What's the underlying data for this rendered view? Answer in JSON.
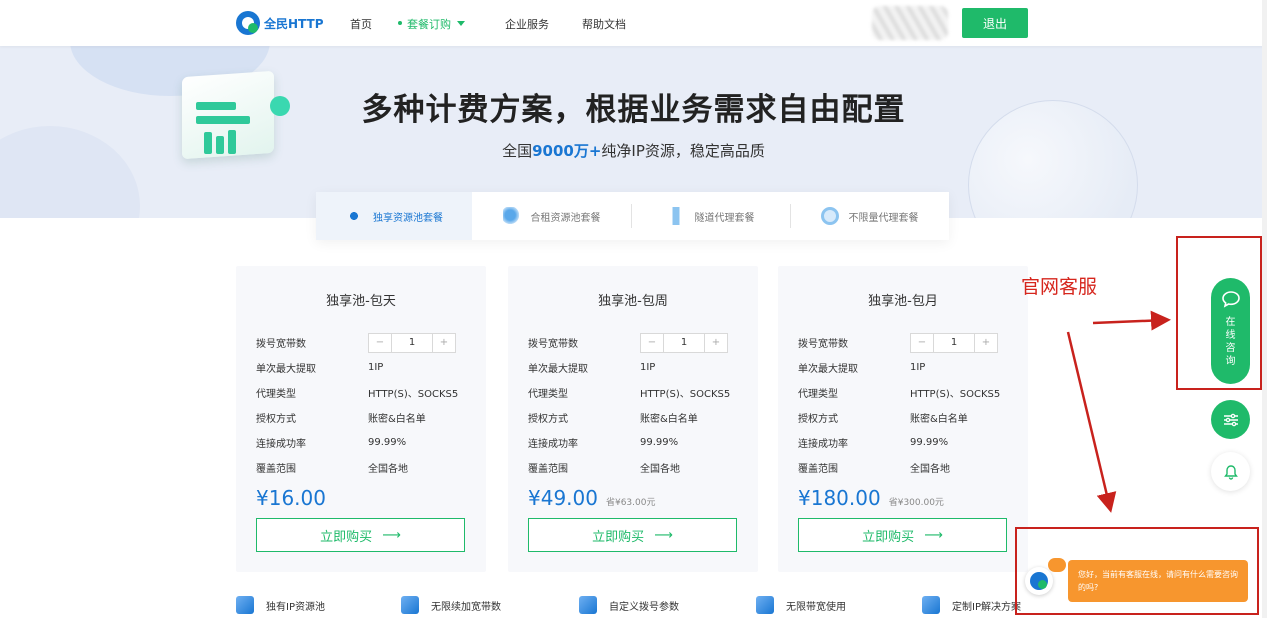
{
  "header": {
    "logo_text": "全民HTTP",
    "nav": [
      "首页",
      "套餐订购",
      "企业服务",
      "帮助文档"
    ],
    "active_nav": "套餐订购",
    "logout_label": "退出"
  },
  "hero": {
    "headline": "多种计费方案，根据业务需求自由配置",
    "sub_prefix": "全国",
    "sub_highlight": "9000万+",
    "sub_suffix": "纯净IP资源，稳定高品质"
  },
  "tabs": [
    {
      "label": "独享资源池套餐",
      "active": true
    },
    {
      "label": "合租资源池套餐",
      "active": false
    },
    {
      "label": "隧道代理套餐",
      "active": false
    },
    {
      "label": "不限量代理套餐",
      "active": false
    }
  ],
  "spec_labels": [
    "拨号宽带数",
    "单次最大提取",
    "代理类型",
    "授权方式",
    "连接成功率",
    "覆盖范围"
  ],
  "cards": [
    {
      "title": "独享池-包天",
      "qty": "1",
      "max_extract": "1IP",
      "proxy_type": "HTTP(S)、SOCKS5",
      "auth": "账密&白名单",
      "success_rate": "99.99%",
      "coverage": "全国各地",
      "price": "¥16.00",
      "original": "",
      "buy": "立即购买"
    },
    {
      "title": "独享池-包周",
      "qty": "1",
      "max_extract": "1IP",
      "proxy_type": "HTTP(S)、SOCKS5",
      "auth": "账密&白名单",
      "success_rate": "99.99%",
      "coverage": "全国各地",
      "price": "¥49.00",
      "original": "省¥63.00元",
      "buy": "立即购买"
    },
    {
      "title": "独享池-包月",
      "qty": "1",
      "max_extract": "1IP",
      "proxy_type": "HTTP(S)、SOCKS5",
      "auth": "账密&白名单",
      "success_rate": "99.99%",
      "coverage": "全国各地",
      "price": "¥180.00",
      "original": "省¥300.00元",
      "buy": "立即购买"
    }
  ],
  "stepper": {
    "minus": "−",
    "plus": "+"
  },
  "buy_arrow": "⟶",
  "features": [
    "独有IP资源池",
    "无限续加宽带数",
    "自定义拨号参数",
    "无限带宽使用",
    "定制IP解决方案"
  ],
  "annotation": "官网客服",
  "side": {
    "consult_chars": [
      "在",
      "线",
      "咨",
      "询"
    ]
  },
  "chat": {
    "message": "您好，当前有客服在线，请问有什么需要咨询的吗?"
  },
  "colors": {
    "brand_green": "#1fba6a",
    "brand_blue": "#1976d2",
    "annotation_red": "#d6261d",
    "chat_orange": "#f7962e"
  }
}
